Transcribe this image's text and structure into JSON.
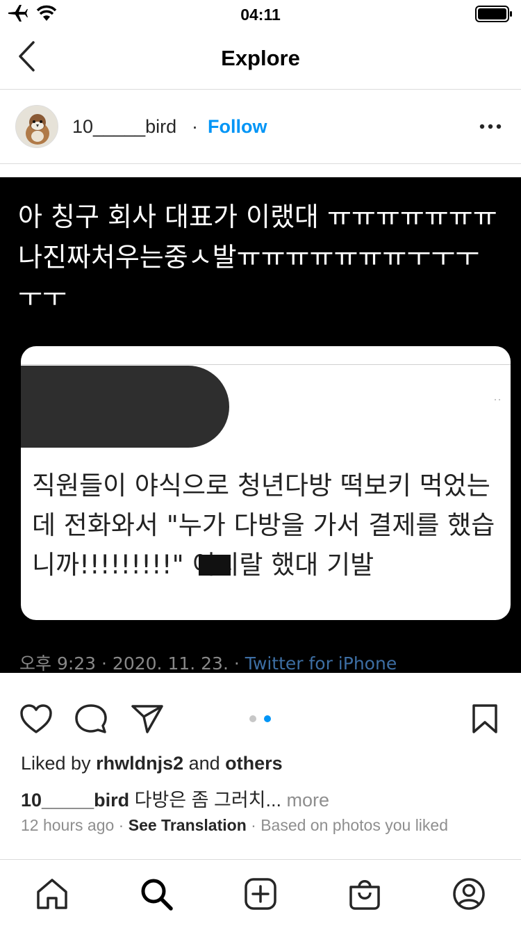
{
  "status_bar": {
    "time": "04:11"
  },
  "nav": {
    "title": "Explore"
  },
  "post": {
    "username": "10_____bird",
    "separator": "·",
    "follow_label": "Follow",
    "image": {
      "tweet_text": "아 칭구 회사 대표가 이랬대 ㅠㅠㅠㅠㅠㅠㅠ\n나진짜처우는중ㅅ발ㅠㅠㅠㅠㅠㅠㅠㅜㅜㅜ\nㅜㅜ",
      "card_text": "직원들이 야식으로 청년다방 떡보키 먹었는\n데 전화와서 \"누가 다방을 가서 결제를 했습\n니까!!!!!!!!!\" 이지랄 했대 기발",
      "card_dots": "··",
      "tweet_meta": "오후 9:23 · 2020. 11. 23. · ",
      "tweet_source": "Twitter for iPhone"
    },
    "likes": {
      "prefix": "Liked by ",
      "user": "rhwldnjs2",
      "middle": " and ",
      "suffix": "others"
    },
    "caption": {
      "user": "10_____bird",
      "text": " 다방은 좀 그러치... ",
      "more": "more"
    },
    "meta": {
      "time": "12 hours ago",
      "sep": " · ",
      "translation": "See Translation",
      "sep2": " · ",
      "reason": "Based on photos you liked"
    },
    "carousel": {
      "count": 2,
      "active": 2
    }
  },
  "icons": {
    "like": "heart-icon",
    "comment": "comment-icon",
    "share": "paper-plane-icon",
    "save": "bookmark-icon",
    "tabs": [
      "home-icon",
      "search-icon",
      "create-icon",
      "shop-icon",
      "profile-icon"
    ]
  },
  "colors": {
    "link": "#0095f6",
    "text": "#262626",
    "muted": "#8e8e8e",
    "divider": "#dbdbdb"
  }
}
